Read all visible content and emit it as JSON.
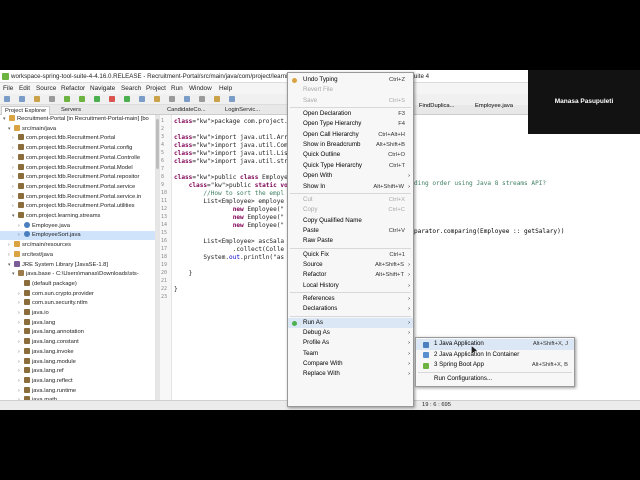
{
  "window": {
    "title": "workspace-spring-tool-suite-4-4.16.0.RELEASE - Recruitment-Portal/src/main/java/com/project/learning/streams/EmployeeSort.java - Spring Tool Suite 4"
  },
  "menubar": [
    "File",
    "Edit",
    "Source",
    "Refactor",
    "Navigate",
    "Search",
    "Project",
    "Run",
    "Window",
    "Help"
  ],
  "explorer": {
    "tabs": [
      "Project Explorer",
      "Servers"
    ],
    "items": [
      {
        "arrow": "▾",
        "icon": "folder",
        "label": "Recruitment-Portal [in Recruitment-Portal-main] [bo"
      },
      {
        "arrow": "▾",
        "icon": "folder",
        "label": "src/main/java"
      },
      {
        "arrow": "›",
        "icon": "pkg",
        "label": "com.project.fdb.Recruitment.Portal"
      },
      {
        "arrow": "›",
        "icon": "pkg",
        "label": "com.project.fdb.Recruitment.Portal.config"
      },
      {
        "arrow": "›",
        "icon": "pkg",
        "label": "com.project.fdb.Recruitment.Portal.Controlle"
      },
      {
        "arrow": "›",
        "icon": "pkg",
        "label": "com.project.fdb.Recruitment.Portal.Model"
      },
      {
        "arrow": "›",
        "icon": "pkg",
        "label": "com.project.fdb.Recruitment.Portal.repositor"
      },
      {
        "arrow": "›",
        "icon": "pkg",
        "label": "com.project.fdb.Recruitment.Portal.service"
      },
      {
        "arrow": "›",
        "icon": "pkg",
        "label": "com.project.fdb.Recruitment.Portal.service.in"
      },
      {
        "arrow": "›",
        "icon": "pkg",
        "label": "com.project.fdb.Recruitment.Portal.utilities"
      },
      {
        "arrow": "▾",
        "icon": "pkg",
        "label": "com.project.learning.streams"
      },
      {
        "arrow": "›",
        "icon": "java",
        "label": "Employee.java"
      },
      {
        "arrow": "›",
        "icon": "java",
        "label": "EmployeeSort.java",
        "selected": true
      },
      {
        "arrow": "›",
        "icon": "folder",
        "label": "src/main/resources"
      },
      {
        "arrow": "›",
        "icon": "folder",
        "label": "src/test/java"
      },
      {
        "arrow": "▾",
        "icon": "lib",
        "label": "JRE System Library [JavaSE-1.8]"
      },
      {
        "arrow": "▾",
        "icon": "jar",
        "label": "java.base - C:\\Users\\manas\\Downloads\\sts-"
      },
      {
        "arrow": "",
        "icon": "pkg",
        "label": "(default package)"
      },
      {
        "arrow": "›",
        "icon": "pkg",
        "label": "com.sun.crypto.provider"
      },
      {
        "arrow": "›",
        "icon": "pkg",
        "label": "com.sun.security.ntlm"
      },
      {
        "arrow": "›",
        "icon": "pkg",
        "label": "java.io"
      },
      {
        "arrow": "›",
        "icon": "pkg",
        "label": "java.lang"
      },
      {
        "arrow": "›",
        "icon": "pkg",
        "label": "java.lang.annotation"
      },
      {
        "arrow": "›",
        "icon": "pkg",
        "label": "java.lang.constant"
      },
      {
        "arrow": "›",
        "icon": "pkg",
        "label": "java.lang.invoke"
      },
      {
        "arrow": "›",
        "icon": "pkg",
        "label": "java.lang.module"
      },
      {
        "arrow": "›",
        "icon": "pkg",
        "label": "java.lang.ref"
      },
      {
        "arrow": "›",
        "icon": "pkg",
        "label": "java.lang.reflect"
      },
      {
        "arrow": "›",
        "icon": "pkg",
        "label": "java.lang.runtime"
      },
      {
        "arrow": "›",
        "icon": "pkg",
        "label": "java.math"
      }
    ]
  },
  "editor": {
    "tabs": [
      "CandidateCo...",
      "LoginServic..."
    ],
    "bg_tabs": [
      "FindDuplica...",
      "Employee.java"
    ],
    "lines": [
      "package com.project.learnin",
      "",
      "import java.util.Arrays;",
      "import java.util.Comparato",
      "import java.util.List;",
      "import java.util.stream.Col",
      "",
      "public class EmployeeSort {",
      "    public static void main(St",
      "        //How to sort the empl",
      "        List<Employee> employe",
      "                new Employee(\"",
      "                new Employee(\"",
      "                new Employee(\"",
      "",
      "        List<Employee> ascSala",
      "                .collect(Colle",
      "        System.out.println(\"as",
      "",
      "    }",
      "",
      "}",
      ""
    ],
    "line_numbers": [
      "1",
      "2",
      "3",
      "4",
      "5",
      "6",
      "7",
      "8",
      "9",
      "10",
      "11",
      "12",
      "13",
      "14",
      "15",
      "16",
      "17",
      "18",
      "19",
      "20",
      "21",
      "22",
      "23"
    ],
    "right_text_1": "ding order using Java 8 streams API?",
    "right_text_2": "parator.comparing(Employee :: getSalary))"
  },
  "status": {
    "position": "19 : 6 : 695"
  },
  "context_menu": {
    "items": [
      {
        "label": "Undo Typing",
        "acc": "Ctrl+Z",
        "disabled": false,
        "icon": true
      },
      {
        "label": "Revert File",
        "acc": "",
        "disabled": true
      },
      {
        "label": "Save",
        "acc": "Ctrl+S",
        "disabled": true
      },
      {
        "sep": true
      },
      {
        "label": "Open Declaration",
        "acc": "F3"
      },
      {
        "label": "Open Type Hierarchy",
        "acc": "F4"
      },
      {
        "label": "Open Call Hierarchy",
        "acc": "Ctrl+Alt+H"
      },
      {
        "label": "Show in Breadcrumb",
        "acc": "Alt+Shift+B"
      },
      {
        "label": "Quick Outline",
        "acc": "Ctrl+O"
      },
      {
        "label": "Quick Type Hierarchy",
        "acc": "Ctrl+T"
      },
      {
        "label": "Open With",
        "acc": "",
        "sub": true
      },
      {
        "label": "Show In",
        "acc": "Alt+Shift+W",
        "sub": true
      },
      {
        "sep": true
      },
      {
        "label": "Cut",
        "acc": "Ctrl+X",
        "disabled": true
      },
      {
        "label": "Copy",
        "acc": "Ctrl+C",
        "disabled": true
      },
      {
        "label": "Copy Qualified Name",
        "acc": ""
      },
      {
        "label": "Paste",
        "acc": "Ctrl+V"
      },
      {
        "label": "Raw Paste",
        "acc": ""
      },
      {
        "sep": true
      },
      {
        "label": "Quick Fix",
        "acc": "Ctrl+1"
      },
      {
        "label": "Source",
        "acc": "Alt+Shift+S",
        "sub": true
      },
      {
        "label": "Refactor",
        "acc": "Alt+Shift+T",
        "sub": true
      },
      {
        "label": "Local History",
        "acc": "",
        "sub": true
      },
      {
        "sep": true
      },
      {
        "label": "References",
        "acc": "",
        "sub": true
      },
      {
        "label": "Declarations",
        "acc": "",
        "sub": true
      },
      {
        "sep": true
      },
      {
        "label": "Run As",
        "acc": "",
        "sub": true,
        "highlight": true
      },
      {
        "label": "Debug As",
        "acc": "",
        "sub": true
      },
      {
        "label": "Profile As",
        "acc": "",
        "sub": true
      },
      {
        "label": "Team",
        "acc": "",
        "sub": true
      },
      {
        "label": "Compare With",
        "acc": "",
        "sub": true
      },
      {
        "label": "Replace With",
        "acc": "",
        "sub": true
      }
    ]
  },
  "run_as_submenu": {
    "items": [
      {
        "label": "1 Java Application",
        "acc": "Alt+Shift+X, J",
        "icon": "#4a7fbf",
        "highlight": true
      },
      {
        "label": "2 Java Application In Container",
        "acc": "",
        "icon": "#5a8fcf"
      },
      {
        "label": "3 Spring Boot App",
        "acc": "Alt+Shift+X, B",
        "icon": "#6db33f"
      },
      {
        "sep": true
      },
      {
        "label": "Run Configurations...",
        "acc": ""
      }
    ]
  },
  "webcam": {
    "name": "Manasa Pasupuleti"
  },
  "colors": {
    "keyword": "#7f0055",
    "comment": "#3f7f5f",
    "string": "#2a00ff",
    "selection": "#cfe3fb",
    "menu_highlight": "#dbe7f5"
  }
}
